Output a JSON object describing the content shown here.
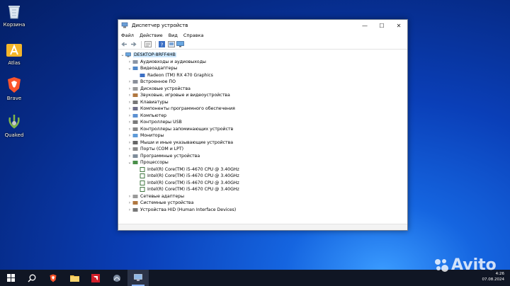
{
  "desktop": {
    "icons": [
      {
        "label": "Корзина",
        "icon": "recycle-bin-icon"
      },
      {
        "label": "Atlas",
        "icon": "atlas-icon"
      },
      {
        "label": "Brave",
        "icon": "brave-browser-icon"
      },
      {
        "label": "Quaked",
        "icon": "quaked-icon"
      }
    ]
  },
  "window": {
    "title": "Диспетчер устройств",
    "controls": {
      "minimize": "—",
      "maximize": "☐",
      "close": "✕"
    },
    "menu": [
      "Файл",
      "Действие",
      "Вид",
      "Справка"
    ]
  },
  "tree": {
    "root": "DESKTOP-8RFF4HB",
    "items": [
      {
        "label": "Аудиовходы и аудиовыходы",
        "expand": "›",
        "depth": 1
      },
      {
        "label": "Видеоадаптеры",
        "expand": "⌄",
        "depth": 1
      },
      {
        "label": "Radeon (TM) RX 470 Graphics",
        "expand": "",
        "depth": 2
      },
      {
        "label": "Встроенное ПО",
        "expand": "›",
        "depth": 1
      },
      {
        "label": "Дисковые устройства",
        "expand": "›",
        "depth": 1
      },
      {
        "label": "Звуковые, игровые и видеоустройства",
        "expand": "›",
        "depth": 1
      },
      {
        "label": "Клавиатуры",
        "expand": "›",
        "depth": 1
      },
      {
        "label": "Компоненты программного обеспечения",
        "expand": "›",
        "depth": 1
      },
      {
        "label": "Компьютер",
        "expand": "›",
        "depth": 1
      },
      {
        "label": "Контроллеры USB",
        "expand": "›",
        "depth": 1
      },
      {
        "label": "Контроллеры запоминающих устройств",
        "expand": "›",
        "depth": 1
      },
      {
        "label": "Мониторы",
        "expand": "›",
        "depth": 1
      },
      {
        "label": "Мыши и иные указывающие устройства",
        "expand": "›",
        "depth": 1
      },
      {
        "label": "Порты (COM и LPT)",
        "expand": "›",
        "depth": 1
      },
      {
        "label": "Программные устройства",
        "expand": "›",
        "depth": 1
      },
      {
        "label": "Процессоры",
        "expand": "⌄",
        "depth": 1
      },
      {
        "label": "Intel(R) Core(TM) i5-4670 CPU @ 3.40GHz",
        "expand": "",
        "depth": 2
      },
      {
        "label": "Intel(R) Core(TM) i5-4670 CPU @ 3.40GHz",
        "expand": "",
        "depth": 2
      },
      {
        "label": "Intel(R) Core(TM) i5-4670 CPU @ 3.40GHz",
        "expand": "",
        "depth": 2
      },
      {
        "label": "Intel(R) Core(TM) i5-4670 CPU @ 3.40GHz",
        "expand": "",
        "depth": 2
      },
      {
        "label": "Сетевые адаптеры",
        "expand": "›",
        "depth": 1
      },
      {
        "label": "Системные устройства",
        "expand": "›",
        "depth": 1
      },
      {
        "label": "Устройства HID (Human Interface Devices)",
        "expand": "›",
        "depth": 1
      }
    ]
  },
  "taskbar": {
    "buttons": [
      "start-icon",
      "search-icon",
      "brave-browser-icon",
      "folder-icon",
      "amd-icon",
      "app-icon",
      "device-manager-icon"
    ],
    "time": "4:26",
    "date": "07.08.2024"
  },
  "watermark": "Avito",
  "colors": {
    "selection": "#cce8ff",
    "taskbar": "#101624",
    "accent": "#0078d7"
  }
}
